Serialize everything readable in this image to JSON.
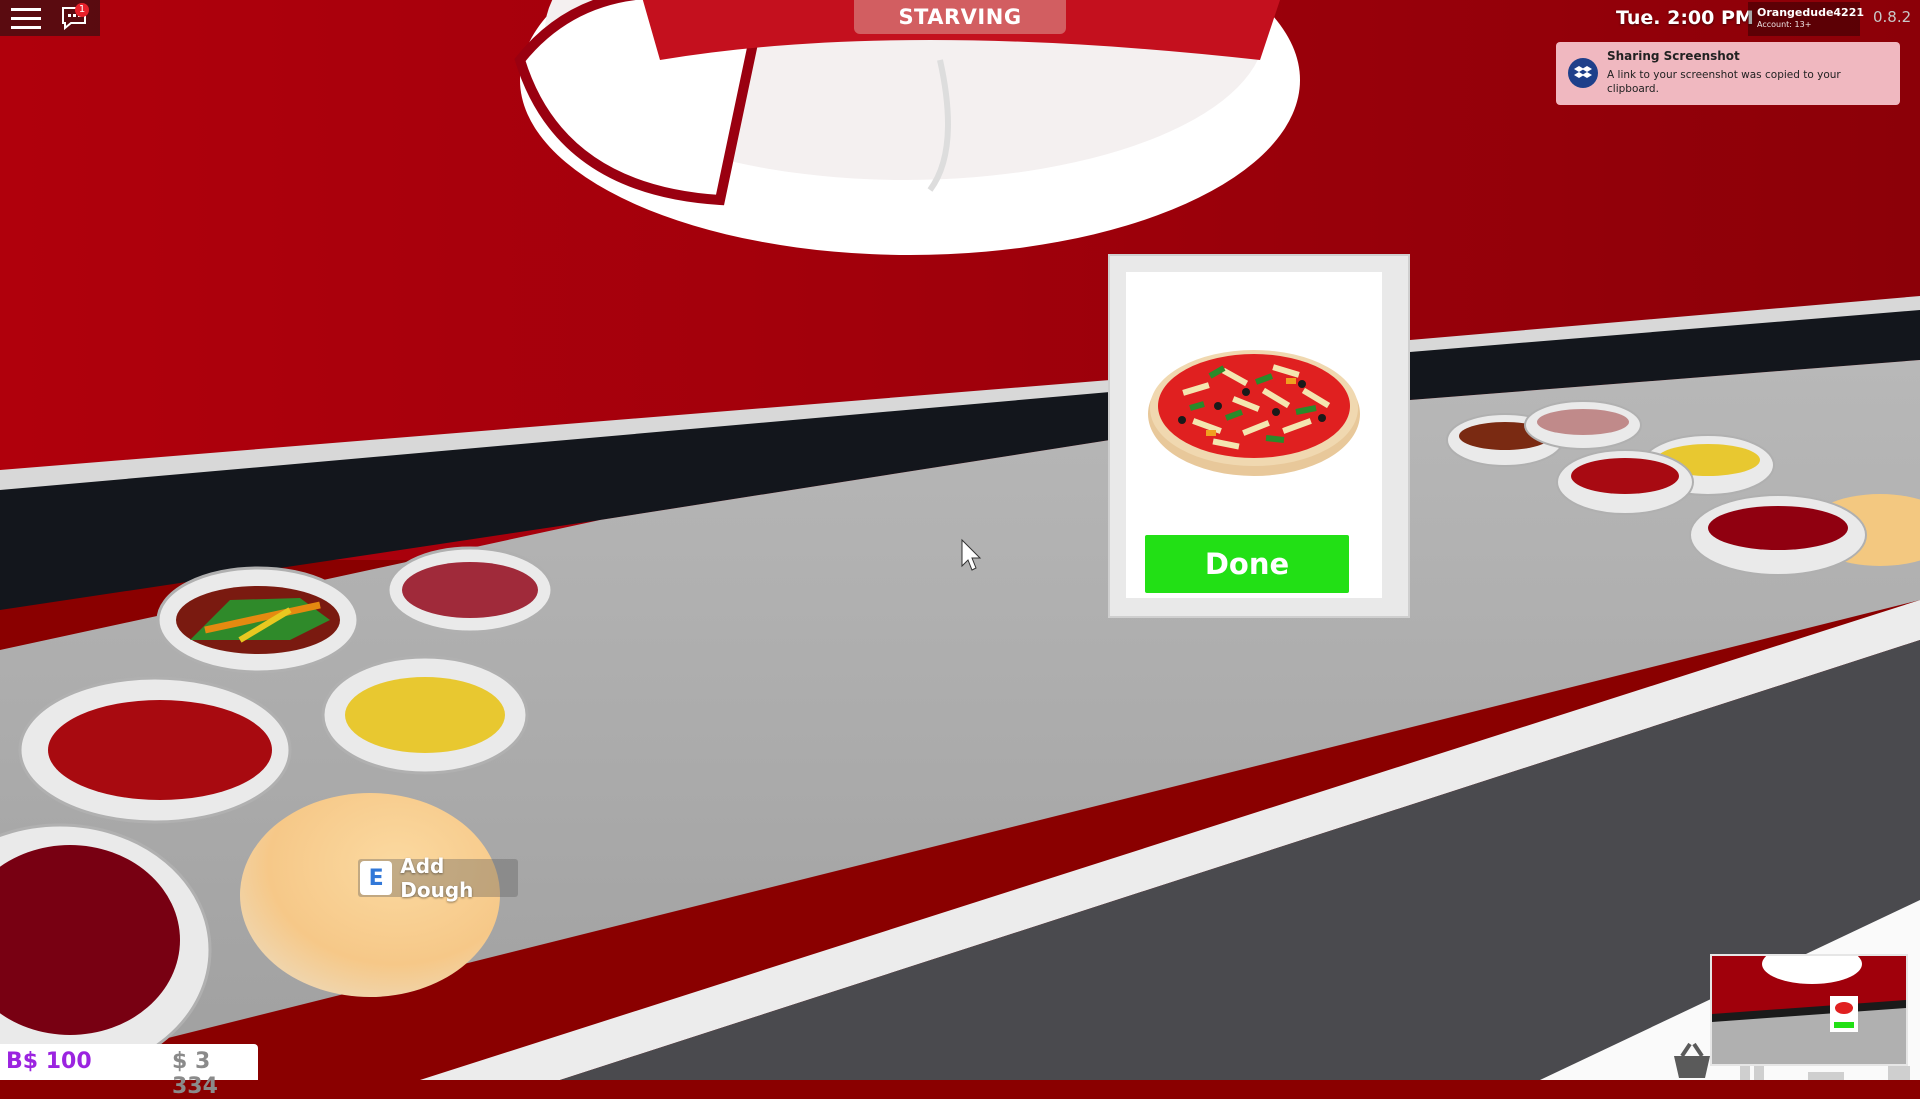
{
  "hud": {
    "status": "STARVING",
    "chat_badge_count": "1",
    "clock": "Tue. 2:00 PM",
    "account": {
      "name": "Orangedude4221",
      "age": "Account: 13+"
    },
    "version": "0.8.2"
  },
  "toast": {
    "title": "Sharing Screenshot",
    "message": "A link to your screenshot was copied to your clipboard.",
    "icon": "dropbox-icon"
  },
  "order_card": {
    "item": "pizza",
    "button_label": "Done"
  },
  "interaction_prompt": {
    "key": "E",
    "label": "Add Dough"
  },
  "currency": {
    "bucks": "B$ 100",
    "cash": "$ 3 334"
  },
  "colors": {
    "wall_red": "#a0000b",
    "counter_gray": "#a9a9a9",
    "done_green": "#22e015",
    "bucks_purple": "#9b24e0",
    "toast_pink": "#f0b8c0"
  }
}
